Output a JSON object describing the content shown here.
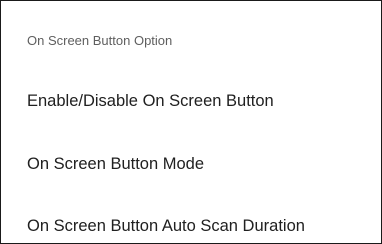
{
  "section": {
    "header": "On Screen Button Option"
  },
  "items": [
    {
      "label": "Enable/Disable On Screen Button"
    },
    {
      "label": "On Screen Button Mode"
    },
    {
      "label": "On Screen Button Auto Scan Duration"
    }
  ]
}
